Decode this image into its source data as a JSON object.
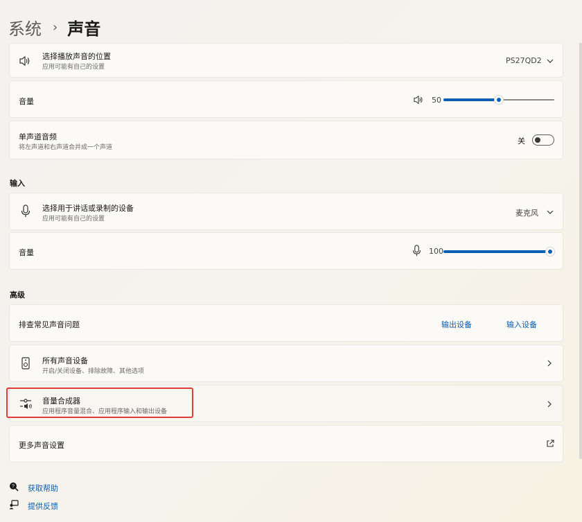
{
  "breadcrumb": {
    "parent": "系统",
    "separator": "›",
    "current": "声音"
  },
  "output": {
    "device": {
      "label": "选择播放声音的位置",
      "sub": "应用可能有自己的设置",
      "value": "PS27QD2"
    },
    "volume": {
      "label": "音量",
      "value": "50",
      "level": 0.5
    },
    "mono": {
      "label": "单声道音频",
      "sub": "将左声道和右声道合并成一个声道",
      "state": "关",
      "on": false
    }
  },
  "input": {
    "heading": "输入",
    "device": {
      "label": "选择用于讲话或录制的设备",
      "sub": "应用可能有自己的设置",
      "value": "麦克风"
    },
    "volume": {
      "label": "音量",
      "value": "100",
      "level": 1.0
    }
  },
  "advanced": {
    "heading": "高级",
    "troubleshoot": {
      "label": "排查常见声音问题",
      "link_output": "输出设备",
      "link_input": "输入设备"
    },
    "all_devices": {
      "label": "所有声音设备",
      "sub": "开启/关闭设备、排除故障、其他选项"
    },
    "mixer": {
      "label": "音量合成器",
      "sub": "应用程序音量混合、应用程序输入和输出设备"
    },
    "more": {
      "label": "更多声音设置"
    }
  },
  "footer": {
    "help": "获取帮助",
    "feedback": "提供反馈"
  },
  "colors": {
    "accent": "#0a5fb4",
    "highlight": "#e23b3b"
  },
  "icons": [
    "speaker-icon",
    "microphone-icon",
    "chevron-down-icon",
    "chevron-right-icon",
    "speaker-device-icon",
    "mixer-icon",
    "external-link-icon",
    "help-icon",
    "feedback-icon"
  ]
}
